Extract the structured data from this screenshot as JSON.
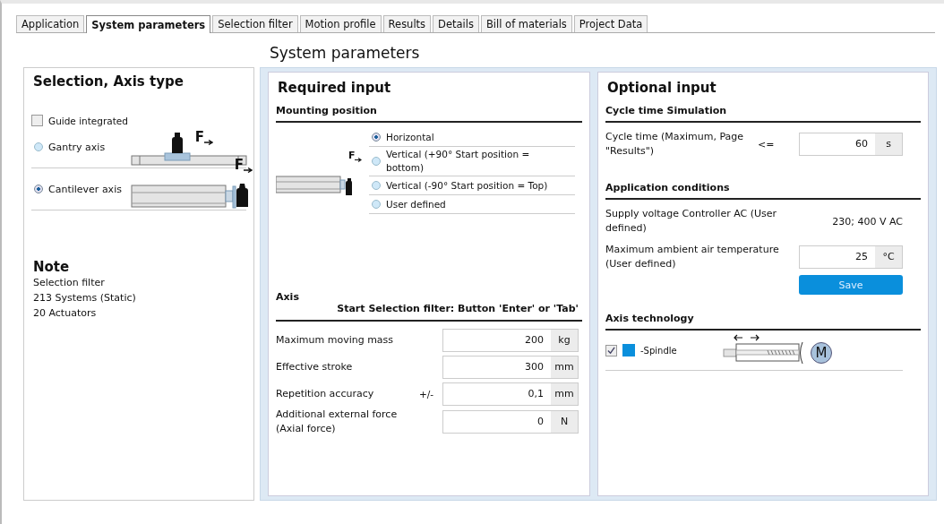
{
  "tabs": [
    {
      "label": "Application",
      "selected": false
    },
    {
      "label": "System parameters",
      "selected": true
    },
    {
      "label": "Selection filter",
      "selected": false
    },
    {
      "label": "Motion profile",
      "selected": false
    },
    {
      "label": "Results",
      "selected": false
    },
    {
      "label": "Details",
      "selected": false
    },
    {
      "label": "Bill of materials",
      "selected": false
    },
    {
      "label": "Project Data",
      "selected": false
    }
  ],
  "page_title": "System parameters",
  "axis_type": {
    "title": "Selection, Axis type",
    "guide_integrated": {
      "label": "Guide integrated",
      "checked": false
    },
    "options": [
      {
        "kind": "gantry",
        "label": "Gantry axis",
        "selected": false,
        "force": "F"
      },
      {
        "kind": "cantilever",
        "label": "Cantilever axis",
        "selected": true,
        "force": "F"
      }
    ]
  },
  "note": {
    "title": "Note",
    "lines": [
      "Selection filter",
      "213 Systems (Static)",
      "20 Actuators"
    ]
  },
  "required": {
    "title": "Required input",
    "mounting": {
      "title": "Mounting position",
      "force": "F",
      "options": [
        {
          "label": "Horizontal",
          "selected": true
        },
        {
          "label": "Vertical (+90° Start position = bottom)",
          "selected": false
        },
        {
          "label": "Vertical (-90° Start position = Top)",
          "selected": false
        },
        {
          "label": "User defined",
          "selected": false
        }
      ]
    },
    "axis": {
      "title": "Axis",
      "hint": "Start Selection filter: Button 'Enter' or 'Tab'",
      "fields": [
        {
          "label": "Maximum moving mass",
          "value": "200",
          "unit": "kg"
        },
        {
          "label": "Effective stroke",
          "value": "300",
          "unit": "mm"
        },
        {
          "label": "Repetition accuracy",
          "qualifier": "+/-",
          "value": "0,1",
          "unit": "mm"
        },
        {
          "label": "Additional external force (Axial force)",
          "value": "0",
          "unit": "N"
        }
      ]
    }
  },
  "optional": {
    "title": "Optional input",
    "cycle": {
      "title": "Cycle time Simulation",
      "fields": [
        {
          "label": "Cycle time (Maximum, Page \"Results\")",
          "qualifier": "<=",
          "value": "60",
          "unit": "s"
        }
      ]
    },
    "conditions": {
      "title": "Application conditions",
      "items": [
        {
          "kind": "text",
          "label": "Supply voltage Controller AC (User defined)",
          "value": "230; 400 V AC"
        },
        {
          "kind": "field",
          "label": "Maximum ambient air temperature (User defined)",
          "value": "25",
          "unit": "°C"
        }
      ],
      "save": "Save"
    },
    "technology": {
      "title": "Axis technology",
      "items": [
        {
          "label": "-Spindle",
          "checked": true,
          "color": "#0a8fdc",
          "motor": "M"
        }
      ]
    }
  }
}
